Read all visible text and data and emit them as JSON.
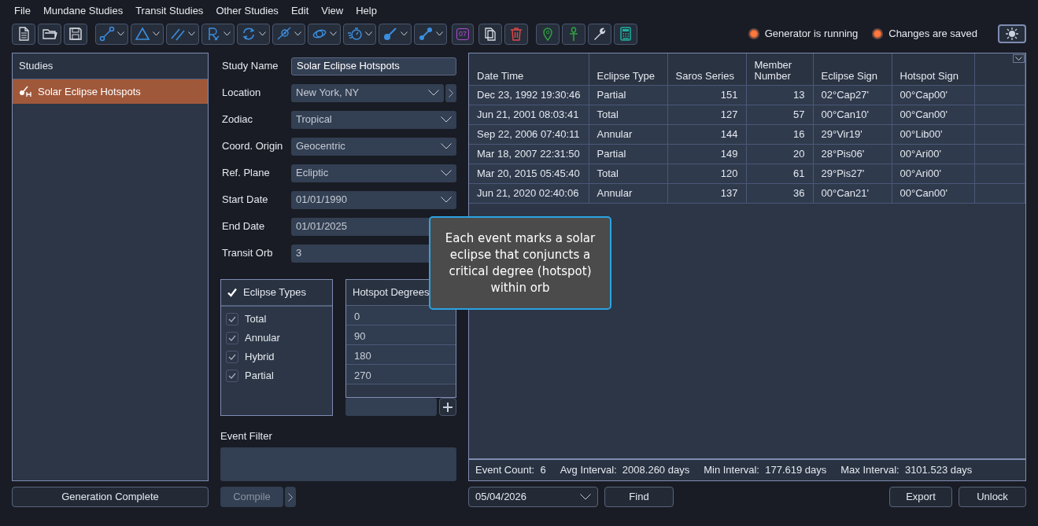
{
  "menu": [
    "File",
    "Mundane Studies",
    "Transit Studies",
    "Other Studies",
    "Edit",
    "View",
    "Help"
  ],
  "toolbar": {
    "calendar_label": "07"
  },
  "indicators": [
    {
      "label": "Generator is running",
      "on": true
    },
    {
      "label": "Changes are saved",
      "on": true
    }
  ],
  "studies": {
    "title": "Studies",
    "items": [
      {
        "label": "Solar Eclipse Hotspots",
        "selected": true
      }
    ],
    "status_button": "Generation Complete"
  },
  "form": {
    "fields": [
      {
        "label": "Study Name",
        "value": "Solar Eclipse Hotspots",
        "kind": "text"
      },
      {
        "label": "Location",
        "value": "New York, NY",
        "kind": "location"
      },
      {
        "label": "Zodiac",
        "value": "Tropical",
        "kind": "select"
      },
      {
        "label": "Coord. Origin",
        "value": "Geocentric",
        "kind": "select"
      },
      {
        "label": "Ref. Plane",
        "value": "Ecliptic",
        "kind": "select"
      },
      {
        "label": "Start Date",
        "value": "01/01/1990",
        "kind": "select"
      },
      {
        "label": "End Date",
        "value": "01/01/2025",
        "kind": "plain"
      },
      {
        "label": "Transit Orb",
        "value": "3",
        "kind": "plain"
      }
    ],
    "eclipse_types": {
      "title": "Eclipse Types",
      "items": [
        {
          "label": "Total",
          "checked": true
        },
        {
          "label": "Annular",
          "checked": true
        },
        {
          "label": "Hybrid",
          "checked": true
        },
        {
          "label": "Partial",
          "checked": true
        }
      ]
    },
    "hotspot_degrees": {
      "title": "Hotspot Degrees",
      "items": [
        "0",
        "90",
        "180",
        "270"
      ]
    },
    "event_filter_label": "Event Filter",
    "compile_button": "Compile"
  },
  "table": {
    "columns": [
      {
        "label": "Date Time",
        "kind": "text"
      },
      {
        "label": "Eclipse Type",
        "kind": "text"
      },
      {
        "label": "Saros Series",
        "kind": "number"
      },
      {
        "label": "Member Number",
        "kind": "number"
      },
      {
        "label": "Eclipse Sign",
        "kind": "text"
      },
      {
        "label": "Hotspot Sign",
        "kind": "text"
      }
    ],
    "rows": [
      [
        "Dec 23, 1992 19:30:46",
        "Partial",
        "151",
        "13",
        "02°Cap27'",
        "00°Cap00'"
      ],
      [
        "Jun 21, 2001 08:03:41",
        "Total",
        "127",
        "57",
        "00°Can10'",
        "00°Can00'"
      ],
      [
        "Sep 22, 2006 07:40:11",
        "Annular",
        "144",
        "16",
        "29°Vir19'",
        "00°Lib00'"
      ],
      [
        "Mar 18, 2007 22:31:50",
        "Partial",
        "149",
        "20",
        "28°Pis06'",
        "00°Ari00'"
      ],
      [
        "Mar 20, 2015 05:45:40",
        "Total",
        "120",
        "61",
        "29°Pis27'",
        "00°Ari00'"
      ],
      [
        "Jun 21, 2020 02:40:06",
        "Annular",
        "137",
        "36",
        "00°Can21'",
        "00°Can00'"
      ]
    ]
  },
  "stats": [
    {
      "label": "Event Count:",
      "value": "6"
    },
    {
      "label": "Avg Interval:",
      "value": "2008.260 days"
    },
    {
      "label": "Min Interval:",
      "value": "177.619 days"
    },
    {
      "label": "Max Interval:",
      "value": "3101.523 days"
    }
  ],
  "bottom": {
    "date": "05/04/2026",
    "find_button": "Find",
    "export_button": "Export",
    "unlock_button": "Unlock"
  },
  "tooltip": "Each event marks a solar eclipse that conjuncts a critical degree (hotspot) within orb"
}
